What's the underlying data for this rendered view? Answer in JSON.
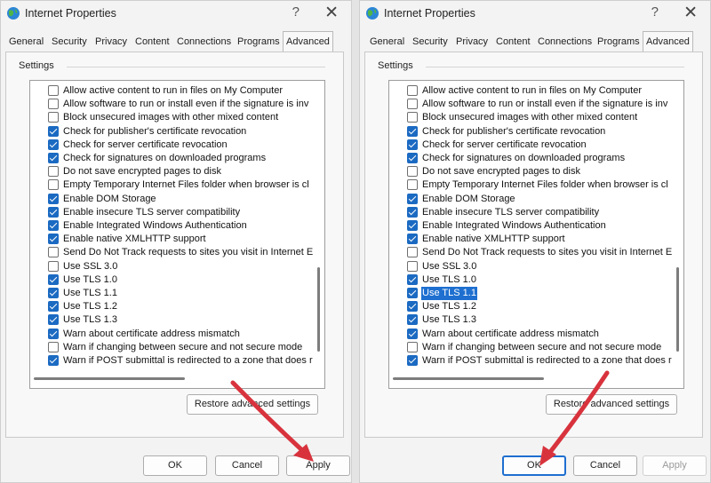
{
  "title": "Internet Properties",
  "help_label": "?",
  "close_label": "✕",
  "tabs": [
    "General",
    "Security",
    "Privacy",
    "Content",
    "Connections",
    "Programs",
    "Advanced"
  ],
  "settings_label": "Settings",
  "settings_left": [
    {
      "label": "Allow active content to run in files on My Computer",
      "checked": false
    },
    {
      "label": "Allow software to run or install even if the signature is inv",
      "checked": false
    },
    {
      "label": "Block unsecured images with other mixed content",
      "checked": false
    },
    {
      "label": "Check for publisher's certificate revocation",
      "checked": true
    },
    {
      "label": "Check for server certificate revocation",
      "checked": true
    },
    {
      "label": "Check for signatures on downloaded programs",
      "checked": true
    },
    {
      "label": "Do not save encrypted pages to disk",
      "checked": false
    },
    {
      "label": "Empty Temporary Internet Files folder when browser is cl",
      "checked": false
    },
    {
      "label": "Enable DOM Storage",
      "checked": true
    },
    {
      "label": "Enable insecure TLS server compatibility",
      "checked": true
    },
    {
      "label": "Enable Integrated Windows Authentication",
      "checked": true
    },
    {
      "label": "Enable native XMLHTTP support",
      "checked": true
    },
    {
      "label": "Send Do Not Track requests to sites you visit in Internet E",
      "checked": false
    },
    {
      "label": "Use SSL 3.0",
      "checked": false
    },
    {
      "label": "Use TLS 1.0",
      "checked": true
    },
    {
      "label": "Use TLS 1.1",
      "checked": true
    },
    {
      "label": "Use TLS 1.2",
      "checked": true
    },
    {
      "label": "Use TLS 1.3",
      "checked": true
    },
    {
      "label": "Warn about certificate address mismatch",
      "checked": true
    },
    {
      "label": "Warn if changing between secure and not secure mode",
      "checked": false
    },
    {
      "label": "Warn if POST submittal is redirected to a zone that does r",
      "checked": true
    }
  ],
  "settings_right": [
    {
      "label": "Allow active content to run in files on My Computer",
      "checked": false
    },
    {
      "label": "Allow software to run or install even if the signature is inv",
      "checked": false
    },
    {
      "label": "Block unsecured images with other mixed content",
      "checked": false
    },
    {
      "label": "Check for publisher's certificate revocation",
      "checked": true
    },
    {
      "label": "Check for server certificate revocation",
      "checked": true
    },
    {
      "label": "Check for signatures on downloaded programs",
      "checked": true
    },
    {
      "label": "Do not save encrypted pages to disk",
      "checked": false
    },
    {
      "label": "Empty Temporary Internet Files folder when browser is cl",
      "checked": false
    },
    {
      "label": "Enable DOM Storage",
      "checked": true
    },
    {
      "label": "Enable insecure TLS server compatibility",
      "checked": true
    },
    {
      "label": "Enable Integrated Windows Authentication",
      "checked": true
    },
    {
      "label": "Enable native XMLHTTP support",
      "checked": true
    },
    {
      "label": "Send Do Not Track requests to sites you visit in Internet E",
      "checked": false
    },
    {
      "label": "Use SSL 3.0",
      "checked": false
    },
    {
      "label": "Use TLS 1.0",
      "checked": true
    },
    {
      "label": "Use TLS 1.1",
      "checked": true,
      "selected": true
    },
    {
      "label": "Use TLS 1.2",
      "checked": true
    },
    {
      "label": "Use TLS 1.3",
      "checked": true
    },
    {
      "label": "Warn about certificate address mismatch",
      "checked": true
    },
    {
      "label": "Warn if changing between secure and not secure mode",
      "checked": false
    },
    {
      "label": "Warn if POST submittal is redirected to a zone that does r",
      "checked": true
    }
  ],
  "restore_label": "Restore advanced settings",
  "buttons": {
    "ok": "OK",
    "cancel": "Cancel",
    "apply": "Apply"
  },
  "colors": {
    "accent": "#1e6fd0",
    "arrow": "#d8333d"
  }
}
